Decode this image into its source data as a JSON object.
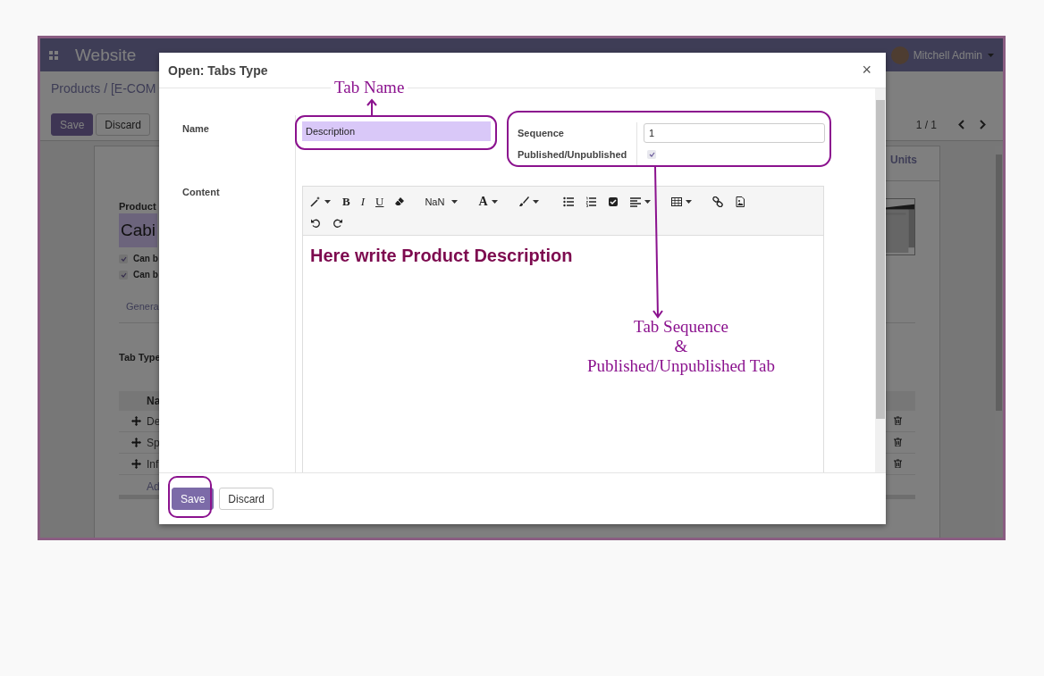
{
  "app": {
    "title": "Website",
    "user": "Mitchell Admin"
  },
  "breadcrumb": "Products / [E-COM",
  "control_buttons": [
    "Save",
    "Discard"
  ],
  "pager": "1 / 1",
  "form_behind": {
    "product_label": "Product",
    "product_name": "Cabi",
    "options": [
      {
        "label": "Can b",
        "checked": true
      },
      {
        "label": "Can b",
        "checked": true
      }
    ],
    "tab": "Genera",
    "section": "Tab Type",
    "table_header": "Na",
    "rows": [
      "De",
      "Sp",
      "Inf"
    ],
    "add_line": "Ad",
    "stat": "Units"
  },
  "dialog": {
    "title": "Open: Tabs Type",
    "close": "×",
    "name_label": "Name",
    "name_value": "Description",
    "sequence_label": "Sequence",
    "sequence_value": "1",
    "published_label": "Published/Unpublished",
    "published": true,
    "content_label": "Content",
    "toolbar": {
      "bold": "B",
      "italic": "I",
      "underline": "U",
      "font_size": "NaN",
      "font_color": "A"
    },
    "content_heading": "Here write Product Description",
    "buttons": [
      "Save",
      "Discard"
    ]
  },
  "annotations": {
    "name_note": "Tab Name",
    "sequence_note": [
      "Tab Sequence",
      "&",
      "Published/Unpublished Tab"
    ]
  }
}
